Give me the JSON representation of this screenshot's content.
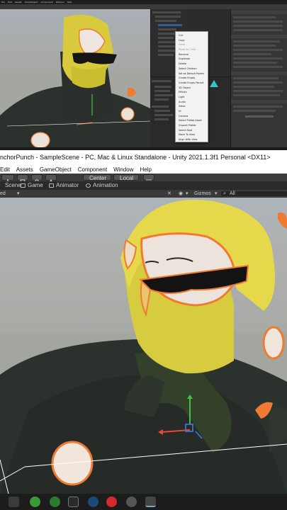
{
  "top_screenshot": {
    "menubar": [
      "File",
      "Edit",
      "Assets",
      "GameObject",
      "Component",
      "Window",
      "Help"
    ],
    "context_menu": {
      "items": [
        {
          "label": "Cut",
          "dim": false
        },
        {
          "label": "Copy",
          "dim": false
        },
        {
          "label": "Paste",
          "dim": true
        },
        {
          "label": "Paste As Child",
          "dim": true
        },
        {
          "label": "Rename",
          "dim": false
        },
        {
          "label": "Duplicate",
          "dim": false
        },
        {
          "label": "Delete",
          "dim": false
        },
        {
          "label": "Select Children",
          "dim": false
        },
        {
          "label": "Set as Default Parent",
          "dim": false
        },
        {
          "label": "Create Empty",
          "dim": false
        },
        {
          "label": "Create Empty Parent",
          "dim": false
        },
        {
          "label": "3D Object",
          "dim": false
        },
        {
          "label": "Effects",
          "dim": false
        },
        {
          "label": "Light",
          "dim": false
        },
        {
          "label": "Audio",
          "dim": false
        },
        {
          "label": "Video",
          "dim": false
        },
        {
          "label": "UI",
          "dim": false
        },
        {
          "label": "Camera",
          "dim": false
        },
        {
          "label": "Select Prefab Asset",
          "dim": false
        },
        {
          "label": "Unpack Prefab",
          "dim": false
        },
        {
          "label": "Select Root",
          "dim": false
        },
        {
          "label": "Move To View",
          "dim": false
        },
        {
          "label": "Align With View",
          "dim": false
        },
        {
          "label": "Align View to Selected",
          "dim": false
        },
        {
          "label": "Toggle Active State",
          "dim": false
        },
        {
          "label": "Properties...",
          "dim": false
        }
      ]
    }
  },
  "window": {
    "title": "nchorPunch - SampleScene - PC, Mac & Linux Standalone - Unity 2021.1.3f1 Personal <DX11>"
  },
  "menubar": [
    "Edit",
    "Assets",
    "GameObject",
    "Component",
    "Window",
    "Help"
  ],
  "toolbar": {
    "pivot_label": "Center",
    "space_label": "Local"
  },
  "tabs": [
    {
      "label": "Scene",
      "active": false
    },
    {
      "label": "Game",
      "active": false
    },
    {
      "label": "Animator",
      "active": false
    },
    {
      "label": "Animation",
      "active": false
    }
  ],
  "scene_toolbar": {
    "shading_mode": "ed",
    "gizmos_label": "Gizmos",
    "search_text": "All"
  },
  "taskbar_icons": [
    "start-icon",
    "xbox-icon",
    "xbox-app-icon",
    "epic-games-icon",
    "steam-icon",
    "opera-icon",
    "obs-icon",
    "unity-icon"
  ],
  "colors": {
    "selection_outline": "#f07a32",
    "hair": "#e8d84a",
    "suit": "#2a302c",
    "unity_dark": "#3c3c3c"
  }
}
